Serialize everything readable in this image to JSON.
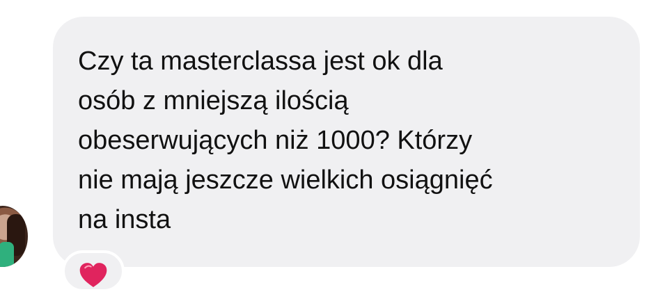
{
  "message": {
    "text": "Czy ta masterclassa jest ok dla\nosób z mniejszą ilością\nobeserwujących niż 1000? Którzy\nnie mają jeszcze wielkich osiągnięć\nna insta"
  },
  "reaction": {
    "icon": "heart-icon",
    "color": "#e0245e"
  },
  "colors": {
    "bubble": "#f0f0f2",
    "text": "#111111"
  }
}
